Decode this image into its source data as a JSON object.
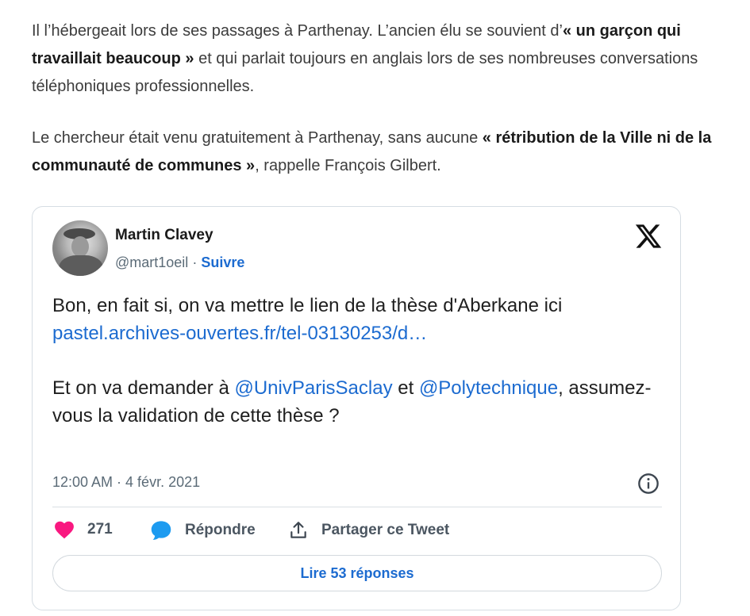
{
  "article": {
    "p1": {
      "t1": "Il l’hébergeait lors de ses passages à Parthenay. L’ancien élu se souvient d’",
      "b1": "« un garçon qui travaillait beaucoup »",
      "t2": " et qui parlait toujours en anglais lors de ses nombreuses conversations téléphoniques professionnelles."
    },
    "p2": {
      "t1": "Le chercheur était venu gratuitement à Parthenay, sans aucune ",
      "b1": "« rétribution de la Ville ni de la communauté de communes »",
      "t2": ", rappelle François Gilbert."
    }
  },
  "tweet": {
    "author_name": "Martin Clavey",
    "handle": "@mart1oeil",
    "separator": " · ",
    "follow_label": "Suivre",
    "text": {
      "line1": "Bon, en fait si, on va mettre le lien de la thèse d'Aberkane ici ",
      "link": "pastel.archives-ouvertes.fr/tel-03130253/d…",
      "p2_t1": "Et on va demander à ",
      "mention1": "@UnivParisSaclay",
      "p2_t2": " et ",
      "mention2": "@Polytechnique",
      "p2_t3": ", assumez-vous la validation de cette thèse ?"
    },
    "timestamp": "12:00 AM · 4 févr. 2021",
    "likes": "271",
    "reply_label": "Répondre",
    "share_label": "Partager ce Tweet",
    "read_replies_label": "Lire 53 réponses",
    "colors": {
      "link": "#1c6bd0",
      "heart": "#f91880",
      "reply_icon": "#1d9bf0"
    },
    "icons": [
      "x-logo-icon",
      "info-icon",
      "heart-icon",
      "reply-bubble-icon",
      "share-icon"
    ]
  }
}
